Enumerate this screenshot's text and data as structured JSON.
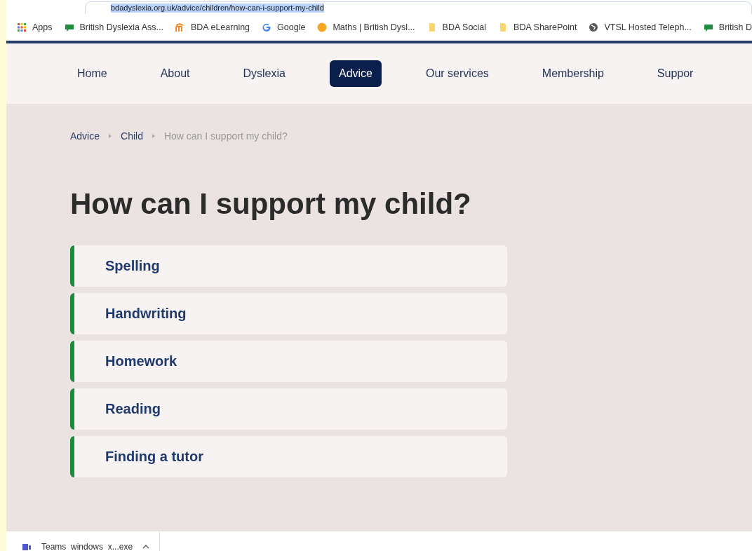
{
  "address_bar": {
    "url": "bdadyslexia.org.uk/advice/children/how-can-i-support-my-child"
  },
  "bookmarks": [
    {
      "label": "Apps",
      "kind": "apps"
    },
    {
      "label": "British Dyslexia Ass...",
      "kind": "chat"
    },
    {
      "label": "BDA eLearning",
      "kind": "moodle"
    },
    {
      "label": "Google",
      "kind": "google"
    },
    {
      "label": "Maths | British Dysl...",
      "kind": "circle"
    },
    {
      "label": "BDA Social",
      "kind": "folder"
    },
    {
      "label": "BDA SharePoint",
      "kind": "folder"
    },
    {
      "label": "VTSL Hosted Teleph...",
      "kind": "globe"
    },
    {
      "label": "British D",
      "kind": "chat"
    }
  ],
  "nav": [
    {
      "label": "Home",
      "selected": false
    },
    {
      "label": "About",
      "selected": false
    },
    {
      "label": "Dyslexia",
      "selected": false
    },
    {
      "label": "Advice",
      "selected": true
    },
    {
      "label": "Our services",
      "selected": false
    },
    {
      "label": "Membership",
      "selected": false
    },
    {
      "label": "Suppor",
      "selected": false
    }
  ],
  "breadcrumb": [
    {
      "label": "Advice",
      "current": false
    },
    {
      "label": "Child",
      "current": false
    },
    {
      "label": "How can I support my child?",
      "current": true
    }
  ],
  "heading": "How can I support my child?",
  "accordion": [
    {
      "label": "Spelling"
    },
    {
      "label": "Handwriting"
    },
    {
      "label": "Homework"
    },
    {
      "label": "Reading"
    },
    {
      "label": "Finding a tutor"
    }
  ],
  "downloads": [
    {
      "label": "Teams_windows_x...exe"
    }
  ]
}
